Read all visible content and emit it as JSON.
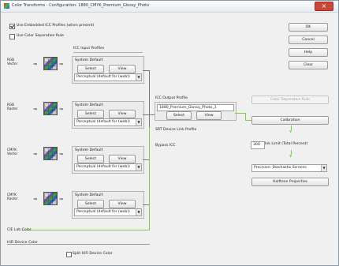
{
  "window": {
    "title": "Color Transforms - Configuration: 1880_CMYK_Premium_Glossy_Photo",
    "close_glyph": "×"
  },
  "options": {
    "use_embedded": {
      "label": "Use Embedded ICC Profiles (when present)",
      "checked": true
    },
    "use_separation": {
      "label": "Use Color Separation Rule",
      "checked": false
    }
  },
  "icc_input_header": "ICC Input Profiles",
  "inputs": [
    {
      "source": "RGB\nVector",
      "profile": "System Default",
      "select_label": "Select",
      "view_label": "View",
      "intent": "Perceptual (default for (web))"
    },
    {
      "source": "RGB\nRaster",
      "profile": "System Default",
      "select_label": "Select",
      "view_label": "View",
      "intent": "Perceptual (default for (web))"
    },
    {
      "source": "CMYK\nVector",
      "profile": "System Default",
      "select_label": "Select",
      "view_label": "View",
      "intent": "Perceptual (default for (web))"
    },
    {
      "source": "CMYK\nRaster",
      "profile": "System Default",
      "select_label": "Select",
      "view_label": "View",
      "intent": "Perceptual (default for (web))"
    }
  ],
  "icc_output": {
    "header": "ICC Output Profile",
    "profile": "1880_Premium_Glossy_Photo_1",
    "select_label": "Select",
    "view_label": "View",
    "device_link_header": "SRT Device Link Profile",
    "device_link_value": "Bypass ICC"
  },
  "right_panel": {
    "ok": "OK",
    "cancel": "Cancel",
    "help": "Help",
    "clear": "Clear",
    "color_separation_rule": "Color Separation Rule",
    "calibration": "Calibration",
    "ink_limit_value": "300",
    "ink_limit_label": "Ink Limit (Total Percent)",
    "screening": "Precision: Stochastic Screens",
    "halftone": "Halftone Properties"
  },
  "bottom": {
    "cie_lab": "CIE Lab Color",
    "hr_device": "HiFi Device Color",
    "split_label": "Split HiFi Device Color"
  },
  "accent_color": "#7fcf4a"
}
